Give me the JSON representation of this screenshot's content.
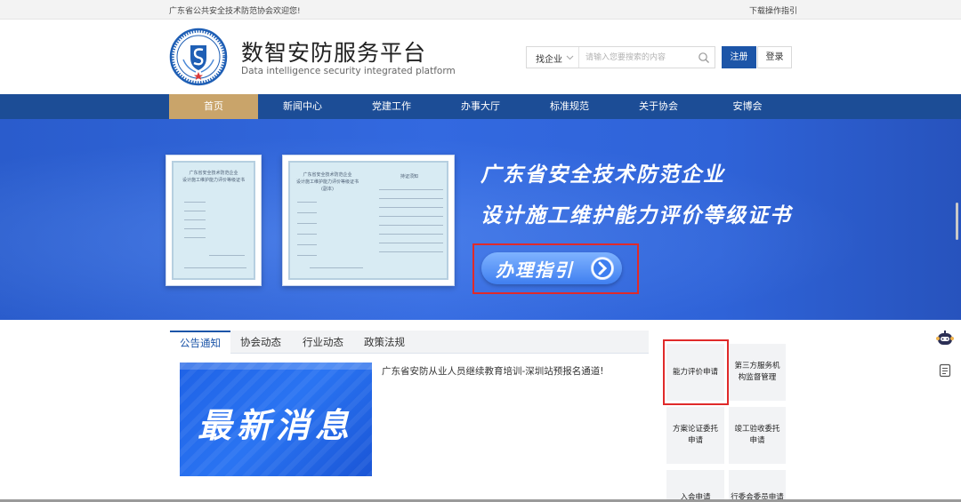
{
  "topbar": {
    "welcome": "广东省公共安全技术防范协会欢迎您!",
    "guide_link": "下载操作指引"
  },
  "header": {
    "logo_seal_text": "广东省公共安全技术防范协会 GDPSPTA",
    "title": "数智安防服务平台",
    "subtitle": "Data intelligence security integrated platform",
    "search": {
      "select_value": "找企业",
      "placeholder": "请输入您要搜索的内容"
    },
    "register_label": "注册",
    "login_label": "登录"
  },
  "nav": {
    "items": [
      {
        "label": "首页",
        "active": true
      },
      {
        "label": "新闻中心"
      },
      {
        "label": "党建工作"
      },
      {
        "label": "办事大厅"
      },
      {
        "label": "标准规范"
      },
      {
        "label": "关于协会"
      },
      {
        "label": "安博会"
      }
    ]
  },
  "banner": {
    "line1": "广东省安全技术防范企业",
    "line2": "设计施工维护能力评价等级证书",
    "button_label": "办理指引",
    "cert_small_title": "广东省安全技术防范企业",
    "cert_small_sub": "设计施工维护能力评价等级证书",
    "cert_large_title": "广东省安全技术防范企业",
    "cert_large_sub": "设计施工维护能力评价等级证书",
    "cert_large_copy": "(副本)",
    "cert_large_notice": "持证须知"
  },
  "tabs": [
    {
      "label": "公告通知",
      "active": true
    },
    {
      "label": "协会动态"
    },
    {
      "label": "行业动态"
    },
    {
      "label": "政策法规"
    }
  ],
  "news": {
    "image_text": "最新消息",
    "title": "广东省安防从业人员继续教育培训-深圳站预报名通道!"
  },
  "quick_links": {
    "ability": "能力评价申请",
    "third_party": "第三方服务机构监督管理",
    "scheme": "方案论证委托申请",
    "acceptance": "竣工验收委托申请",
    "join": "入会申请",
    "committee": "行委会委员申请"
  },
  "colors": {
    "nav_bg": "#1c4d96",
    "nav_active": "#c9a46a",
    "primary": "#1c55a8",
    "highlight": "#e02a2a"
  },
  "icons": [
    "robot-icon",
    "document-icon",
    "search-icon",
    "chevron-down-icon",
    "arrow-right-icon"
  ]
}
